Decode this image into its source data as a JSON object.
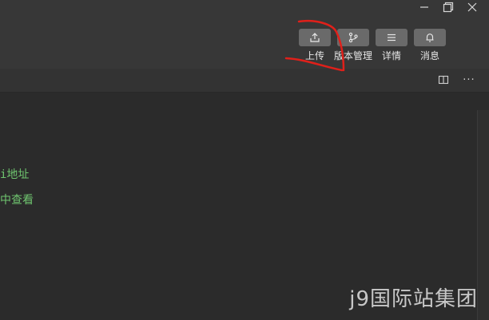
{
  "toolbar": {
    "items": [
      {
        "label": "上传",
        "icon": "upload-icon"
      },
      {
        "label": "版本管理",
        "icon": "branch-icon"
      },
      {
        "label": "详情",
        "icon": "menu-icon"
      },
      {
        "label": "消息",
        "icon": "bell-icon"
      }
    ]
  },
  "window_controls": {
    "minimize": "minimize-icon",
    "restore": "restore-icon",
    "close": "close-icon"
  },
  "tab_actions": {
    "split": "split-editor-icon",
    "more": "···"
  },
  "editor": {
    "lines": [
      "i地址",
      "中查看"
    ]
  },
  "watermark": {
    "text": "j9国际站集团"
  },
  "colors": {
    "titlebar": "#373737",
    "editor_bg": "#2b2b2b",
    "button_bg": "#6a6a6a",
    "code_text": "#6fc46f",
    "annotation_red": "#e0201a"
  }
}
